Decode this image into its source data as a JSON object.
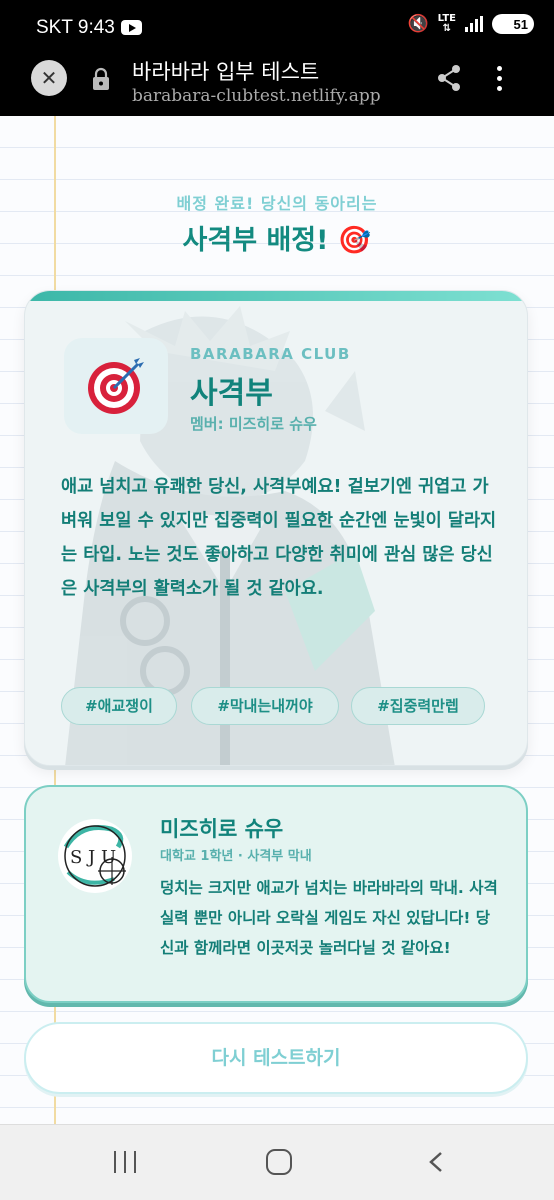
{
  "status_bar": {
    "time": "SKT 9:43",
    "network": "LTE",
    "battery": "51"
  },
  "browser": {
    "title": "바라바라 입부 테스트",
    "host": "barabara-clubtest.netlify.app"
  },
  "result_header": {
    "subtitle": "배정 완료! 당신의 동아리는",
    "title": "사격부 배정! 🎯"
  },
  "club": {
    "icon": "🎯",
    "brand": "BARABARA CLUB",
    "name": "사격부",
    "members": "멤버: 미즈히로 슈우",
    "description": "애교 넘치고 유쾌한 당신, 사격부예요! 겉보기엔 귀엽고 가벼워 보일 수 있지만 집중력이 필요한 순간엔 눈빛이 달라지는 타입. 노는 것도 좋아하고 다양한 취미에 관심 많은 당신은 사격부의 활력소가 될 것 같아요.",
    "tags": [
      "#애교쟁이",
      "#막내는내꺼야",
      "#집중력만렙"
    ]
  },
  "member": {
    "name": "미즈히로 슈우",
    "info": "대학교 1학년 · 사격부 막내",
    "description": "덩치는 크지만 애교가 넘치는 바라바라의 막내. 사격 실력 뿐만 아니라 오락실 게임도 자신 있답니다! 당신과 함께라면 이곳저곳 놀러다닐 것 같아요!",
    "avatar_letters": "S J U"
  },
  "actions": {
    "retry_label": "다시 테스트하기"
  },
  "colors": {
    "accent": "#138a80",
    "light_accent": "#7fcfd3",
    "page_bg": "#fbfcfe"
  }
}
